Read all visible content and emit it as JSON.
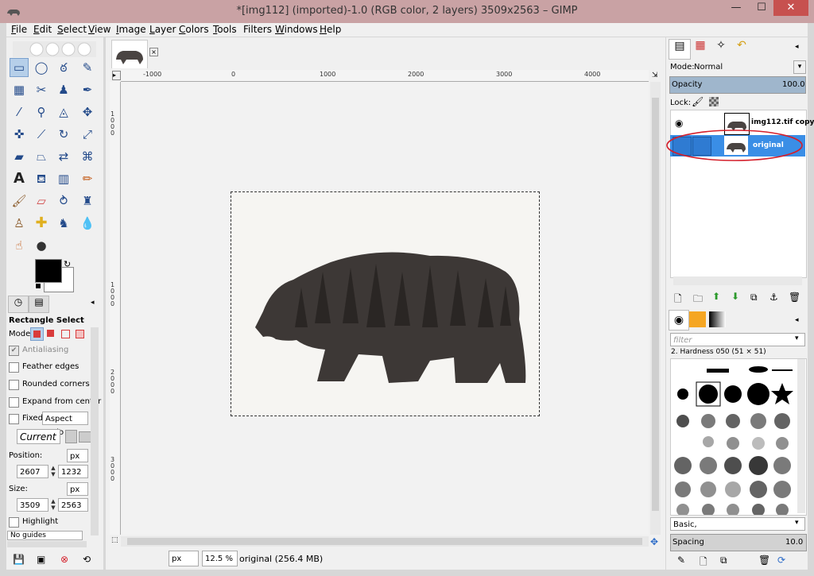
{
  "window": {
    "title": "*[img112] (imported)-1.0 (RGB color, 2 layers) 3509x2563 – GIMP",
    "minimize": "—",
    "maximize": "☐",
    "close": "✕"
  },
  "menu": {
    "items": [
      {
        "key": "F",
        "rest": "ile"
      },
      {
        "key": "E",
        "rest": "dit"
      },
      {
        "key": "S",
        "rest": "elect"
      },
      {
        "key": "V",
        "rest": "iew"
      },
      {
        "key": "I",
        "rest": "mage"
      },
      {
        "key": "L",
        "rest": "ayer"
      },
      {
        "key": "C",
        "rest": "olors"
      },
      {
        "key": "T",
        "rest": "ools"
      },
      {
        "key": "",
        "rest": "Filters"
      },
      {
        "key": "W",
        "rest": "indows"
      },
      {
        "key": "H",
        "rest": "elp"
      }
    ]
  },
  "tool_options": {
    "title": "Rectangle Select",
    "mode_label": "Mode:",
    "antialiasing": "Antialiasing",
    "feather_edges": "Feather edges",
    "rounded_corners": "Rounded corners",
    "expand_from_center": "Expand from center",
    "fixed": "Fixed:",
    "fixed_option": "Aspect ratio",
    "current": "Current",
    "position_label": "Position:",
    "position_unit": "px",
    "position_x": "2607",
    "position_y": "1232",
    "size_label": "Size:",
    "size_unit": "px",
    "size_w": "3509",
    "size_h": "2563",
    "highlight": "Highlight",
    "guides": "No guides"
  },
  "ruler": {
    "h_labels": [
      "-1000",
      "0",
      "1000",
      "2000",
      "3000",
      "4000"
    ],
    "v_labels": [
      "1000",
      "1000",
      "2000",
      "3000"
    ]
  },
  "statusbar": {
    "unit": "px",
    "zoom": "12.5 %",
    "info": "original (256.4 MB)"
  },
  "layers": {
    "mode_label": "Mode:",
    "mode_value": "Normal",
    "opacity_label": "Opacity",
    "opacity_value": "100.0",
    "opacity_fraction": 1.0,
    "lock_label": "Lock:",
    "items": [
      {
        "name": "img112.tif copy"
      },
      {
        "name": "original"
      }
    ]
  },
  "brushes": {
    "filter_placeholder": "filter",
    "brush_name": "2. Hardness 050 (51 × 51)",
    "tag": "Basic,",
    "spacing_label": "Spacing",
    "spacing_value": "10.0"
  },
  "colors": {
    "accent": "#3a8ee6",
    "highlight": "#d41f2b",
    "fg": "#000000",
    "bg": "#ffffff"
  }
}
